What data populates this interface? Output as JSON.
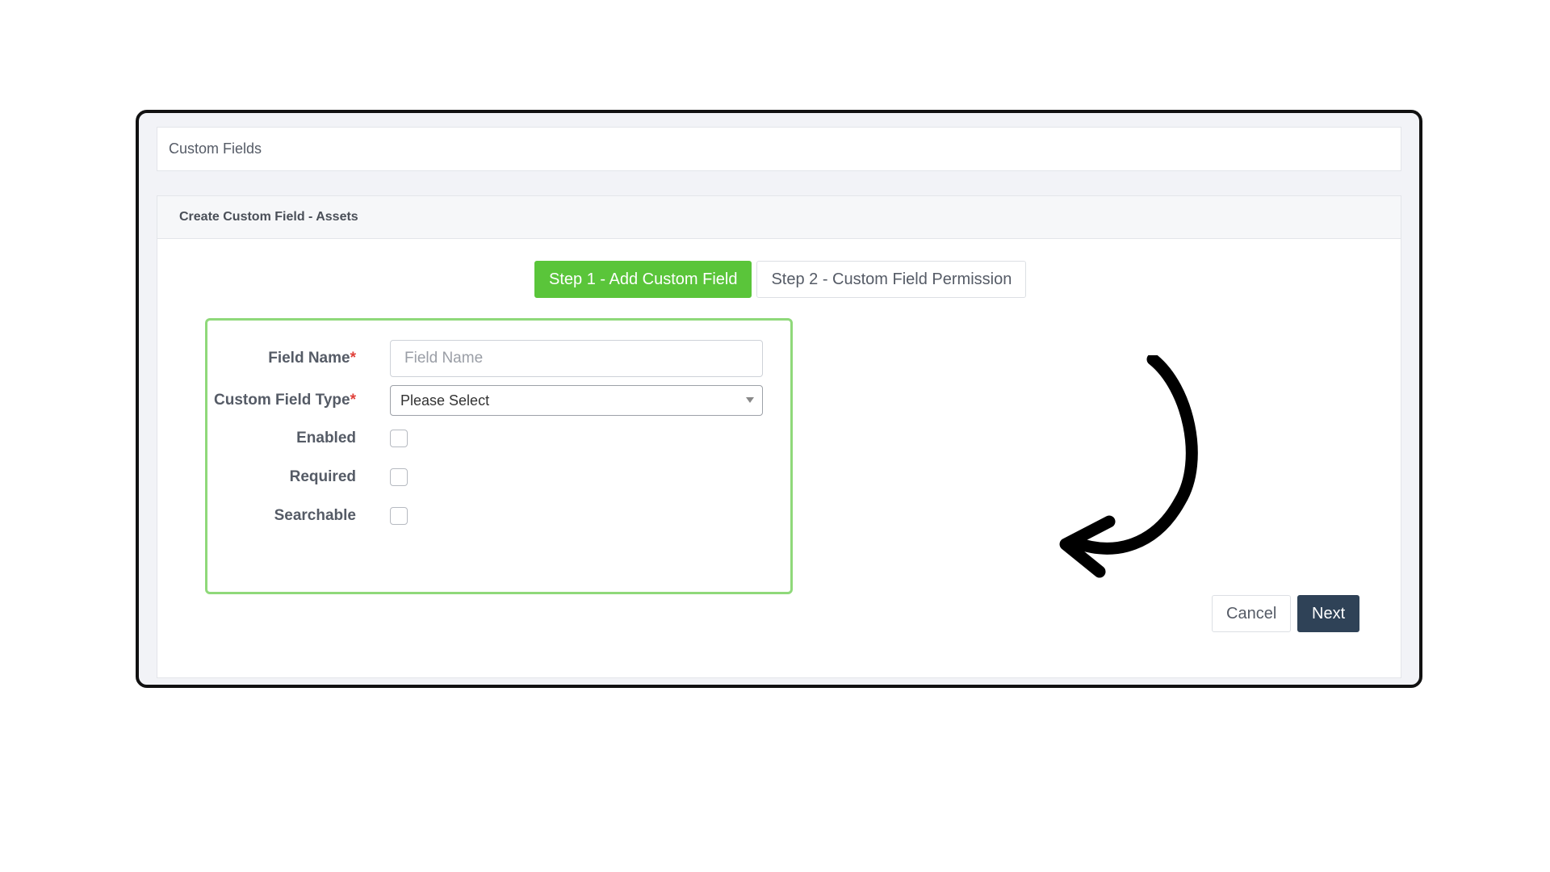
{
  "page": {
    "header_title": "Custom Fields",
    "card_title": "Create Custom Field - Assets"
  },
  "steps": [
    {
      "label": "Step 1 - Add Custom Field",
      "active": true
    },
    {
      "label": "Step 2 - Custom Field Permission",
      "active": false
    }
  ],
  "form": {
    "field_name": {
      "label": "Field Name",
      "required_mark": "*",
      "placeholder": "Field Name",
      "value": ""
    },
    "field_type": {
      "label": "Custom Field Type",
      "required_mark": "*",
      "selected": "Please Select"
    },
    "enabled": {
      "label": "Enabled",
      "checked": false
    },
    "required": {
      "label": "Required",
      "checked": false
    },
    "searchable": {
      "label": "Searchable",
      "checked": false
    }
  },
  "actions": {
    "cancel_label": "Cancel",
    "next_label": "Next"
  },
  "colors": {
    "active_step": "#5ac53a",
    "form_highlight": "#8fd97a",
    "next_button": "#2f4257",
    "required_mark": "#e0413a"
  },
  "annotation": {
    "icon": "curved-arrow-icon"
  }
}
